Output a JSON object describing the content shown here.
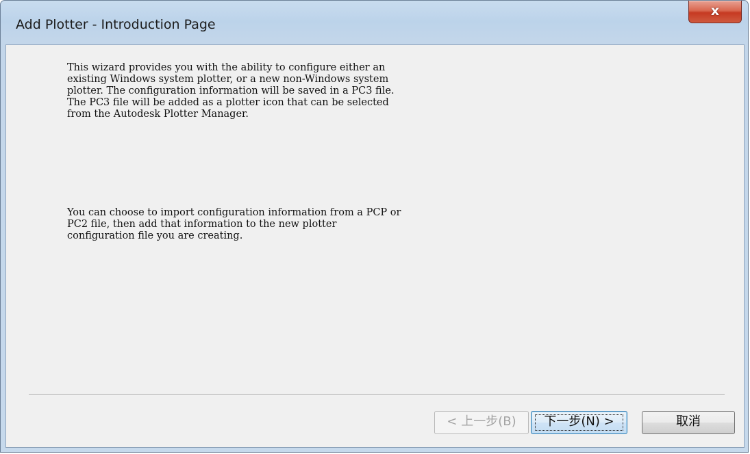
{
  "window": {
    "title": "Add Plotter - Introduction Page",
    "close_label": "x"
  },
  "content": {
    "paragraph1": "This wizard provides you with the ability to configure either an\nexisting Windows system plotter, or a new non-Windows system\nplotter. The configuration information will be saved in a PC3 file.\nThe PC3 file will be added as a plotter icon that can be selected\nfrom the Autodesk Plotter Manager.",
    "paragraph2": "You can choose to import configuration information from a PCP or\nPC2 file, then add that information to the new plotter\nconfiguration file you are creating."
  },
  "buttons": {
    "back_label": "< 上一步(B)",
    "next_label": "下一步(N) >",
    "cancel_label": "取消"
  },
  "colors": {
    "title_bar": "#c3d6ea",
    "client_bg": "#f0f0f0",
    "close_red": "#c63a22",
    "next_focus": "#3c7fb1"
  },
  "icons": {
    "close": "close-icon"
  }
}
